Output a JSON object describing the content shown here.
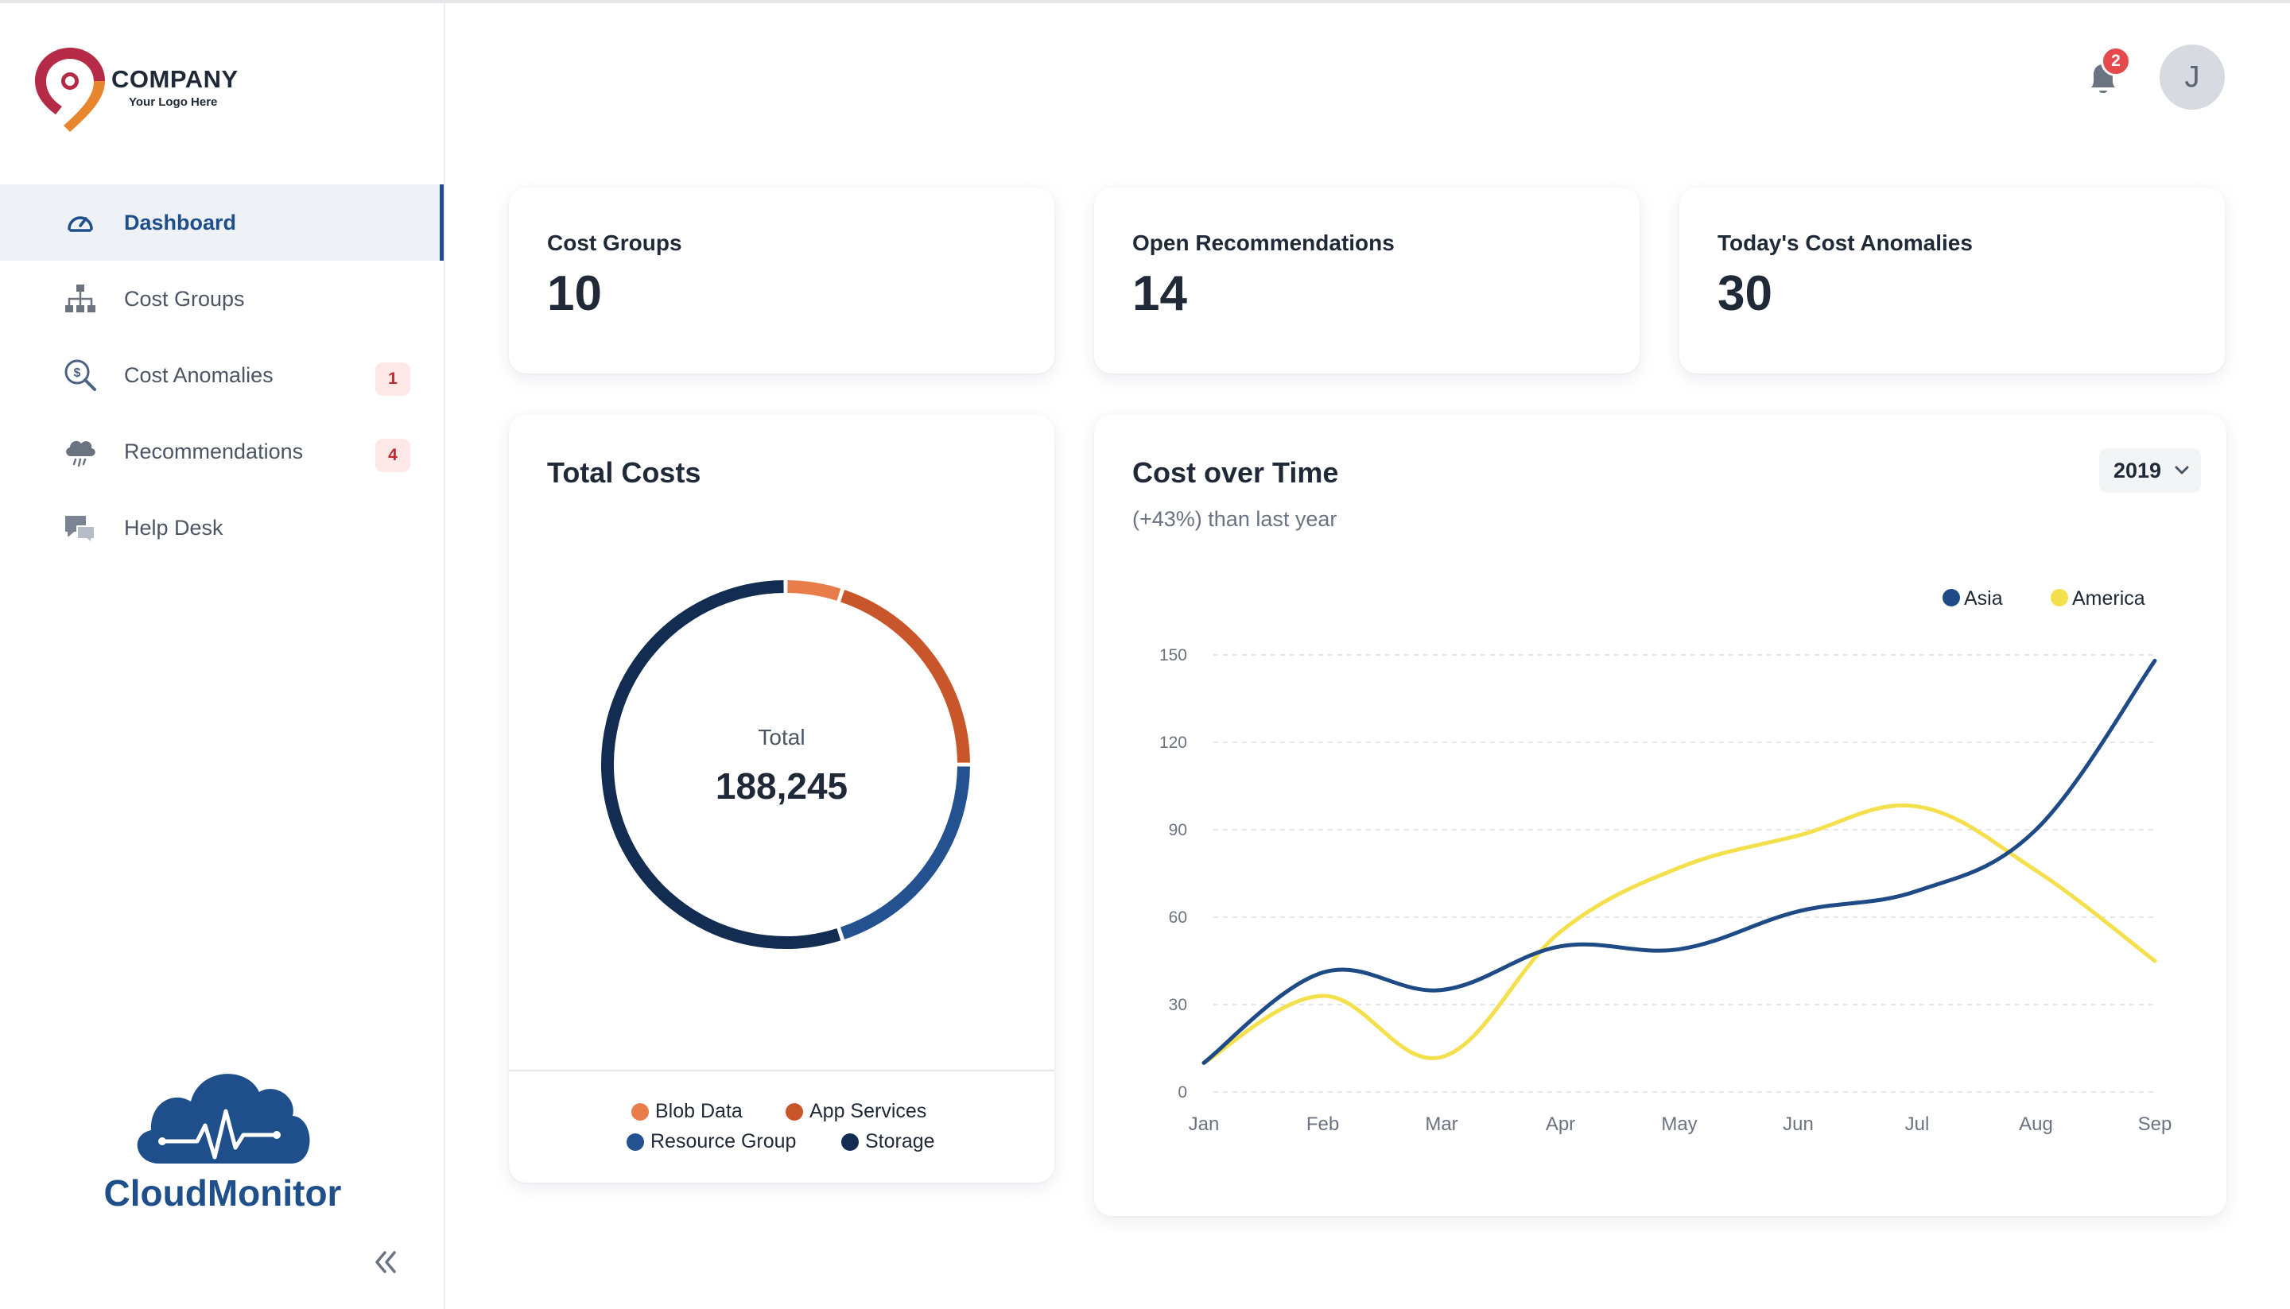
{
  "brand": {
    "company": "COMPANY",
    "tagline": "Your Logo Here",
    "product": "CloudMonitor"
  },
  "sidebar": {
    "items": [
      {
        "label": "Dashboard",
        "icon": "gauge-icon",
        "active": true,
        "badge": ""
      },
      {
        "label": "Cost Groups",
        "icon": "hierarchy-icon",
        "active": false,
        "badge": ""
      },
      {
        "label": "Cost Anomalies",
        "icon": "dollar-search-icon",
        "active": false,
        "badge": "1"
      },
      {
        "label": "Recommendations",
        "icon": "cloud-rain-icon",
        "active": false,
        "badge": "4"
      },
      {
        "label": "Help Desk",
        "icon": "chat-bubbles-icon",
        "active": false,
        "badge": ""
      }
    ]
  },
  "header": {
    "notification_count": "2",
    "avatar_initial": "J"
  },
  "stats": [
    {
      "title": "Cost Groups",
      "value": "10"
    },
    {
      "title": "Open Recommendations",
      "value": "14"
    },
    {
      "title": "Today's Cost Anomalies",
      "value": "30"
    }
  ],
  "total_costs": {
    "title": "Total Costs",
    "center_label": "Total",
    "center_value": "188,245"
  },
  "cost_over_time": {
    "title": "Cost over Time",
    "subtitle": "(+43%) than last year",
    "year": "2019"
  },
  "colors": {
    "primary": "#1f4f8b",
    "blob_data": "#e87c4a",
    "app_services": "#c9562a",
    "resource_group": "#245190",
    "storage": "#132c52",
    "asia": "#1e4a86",
    "america": "#f4e04d"
  },
  "chart_data": [
    {
      "type": "pie",
      "title": "Total Costs",
      "categories": [
        "Blob Data",
        "App Services",
        "Resource Group",
        "Storage"
      ],
      "values": [
        5,
        20,
        20,
        55
      ],
      "unit": "percent of total (estimated from arc lengths)",
      "colors": [
        "#e87c4a",
        "#c9562a",
        "#245190",
        "#132c52"
      ]
    },
    {
      "type": "line",
      "title": "Cost over Time",
      "x": [
        "Jan",
        "Feb",
        "Mar",
        "Apr",
        "May",
        "Jun",
        "Jul",
        "Aug",
        "Sep"
      ],
      "series": [
        {
          "name": "Asia",
          "values": [
            10,
            41,
            35,
            50,
            49,
            62,
            69,
            90,
            148
          ],
          "color": "#1e4a86"
        },
        {
          "name": "America",
          "values": [
            10,
            33,
            12,
            55,
            77,
            88,
            98,
            76,
            45
          ],
          "color": "#f4e04d"
        }
      ],
      "yticks": [
        0,
        30,
        60,
        90,
        120,
        150
      ],
      "ylim": [
        0,
        150
      ],
      "grid": true,
      "legend": "top-right"
    }
  ]
}
